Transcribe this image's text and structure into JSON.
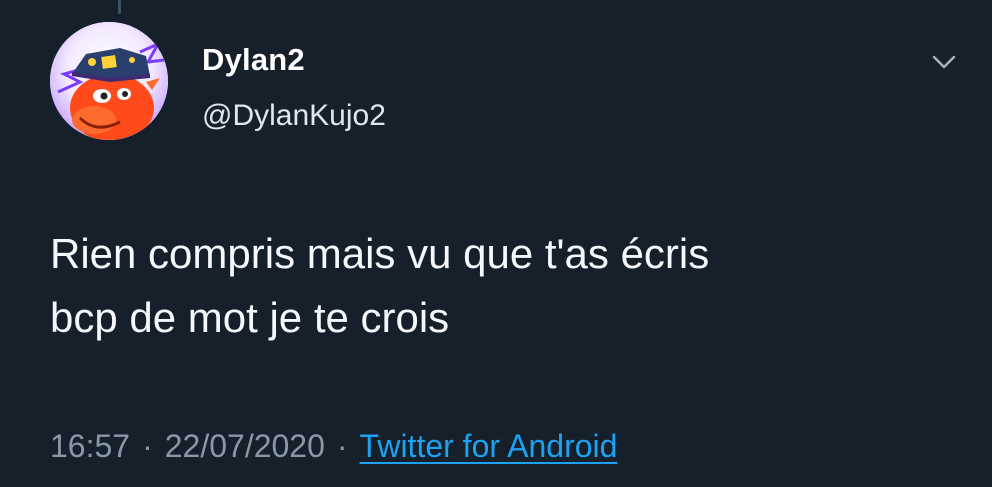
{
  "tweet": {
    "author": {
      "display_name": "Dylan2",
      "handle": "@DylanKujo2"
    },
    "text": "Rien compris mais vu que t'as écris\nbcp de mot je te crois",
    "time": "16:57",
    "separator": "·",
    "date": "22/07/2020",
    "source": "Twitter for Android"
  },
  "icons": {
    "more": "chevron-down-icon",
    "avatar": "avatar-image"
  },
  "colors": {
    "background": "#15202b",
    "text": "#ffffff",
    "secondary_text": "#8899a6",
    "link": "#1da1f2"
  }
}
